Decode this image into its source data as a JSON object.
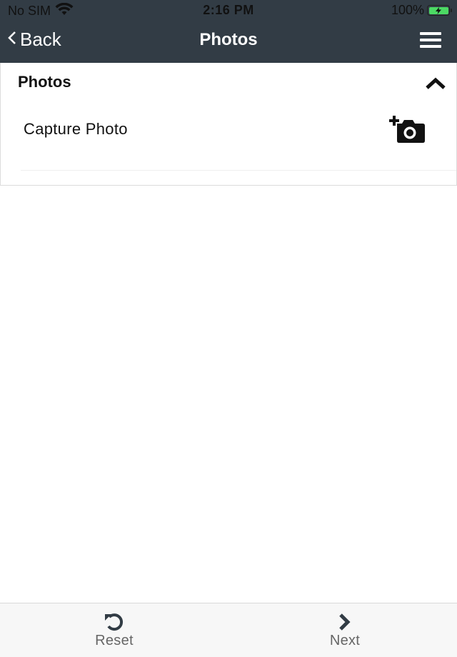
{
  "status_bar": {
    "carrier": "No SIM",
    "time": "2:16 PM",
    "battery_percent": "100%",
    "battery_level": 1.0,
    "charging": true,
    "battery_color": "#4cd964"
  },
  "navbar": {
    "back_label": "Back",
    "title": "Photos",
    "background_color": "#323c45"
  },
  "section": {
    "title": "Photos",
    "expanded": true,
    "items": [
      {
        "label": "Capture Photo",
        "icon": "add-camera-icon"
      }
    ]
  },
  "footer": {
    "reset_label": "Reset",
    "next_label": "Next"
  }
}
